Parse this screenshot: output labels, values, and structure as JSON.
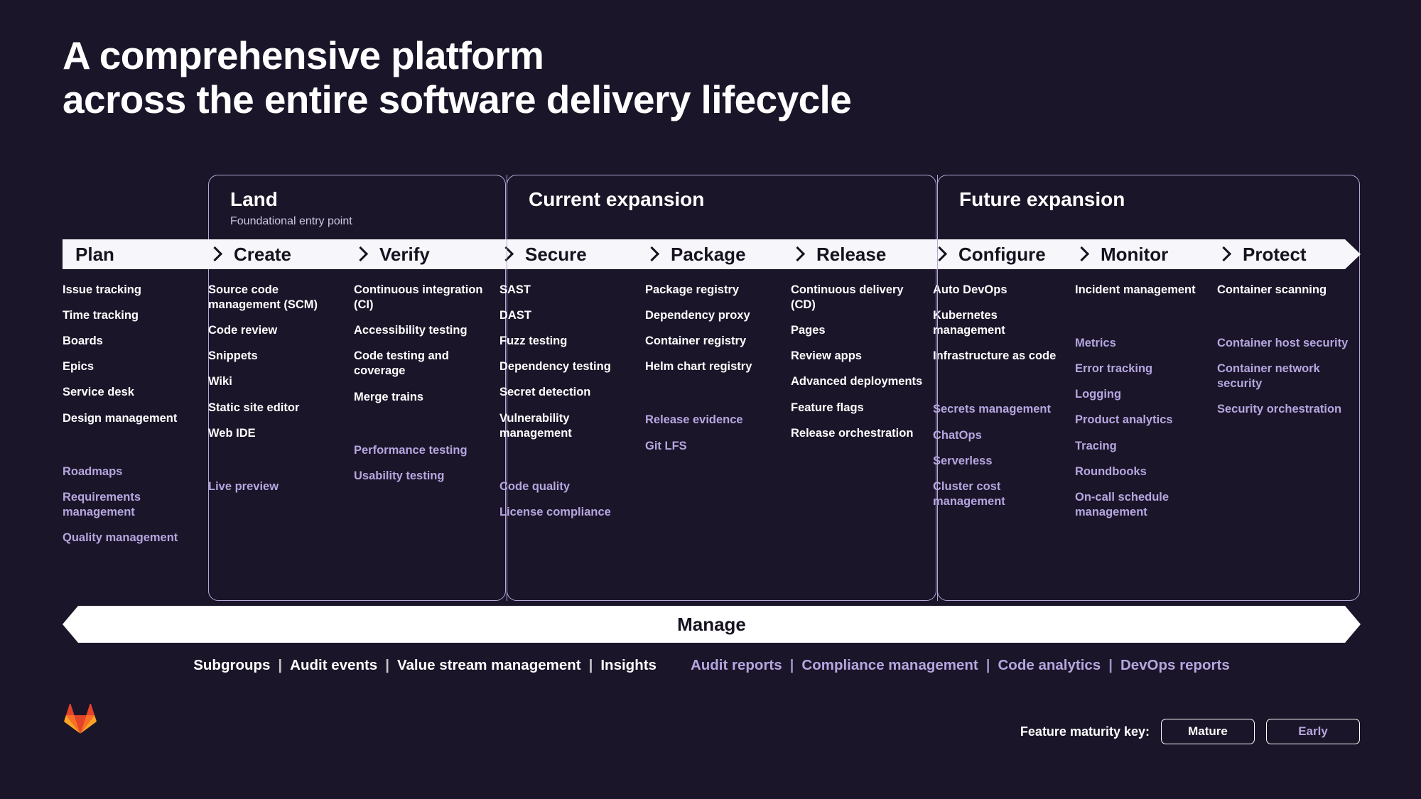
{
  "headline": {
    "line1": "A comprehensive platform",
    "line2": "across the entire software delivery lifecycle"
  },
  "groups": [
    {
      "title": "Land",
      "subtitle": "Foundational entry point"
    },
    {
      "title": "Current expansion",
      "subtitle": ""
    },
    {
      "title": "Future expansion",
      "subtitle": ""
    }
  ],
  "stages": [
    {
      "name": "Plan",
      "mature": [
        "Issue tracking",
        "Time tracking",
        "Boards",
        "Epics",
        "Service desk",
        "Design management"
      ],
      "early": [
        "Roadmaps",
        "Requirements management",
        "Quality management"
      ]
    },
    {
      "name": "Create",
      "mature": [
        "Source code management (SCM)",
        "Code review",
        "Snippets",
        "Wiki",
        "Static site editor",
        "Web IDE"
      ],
      "early": [
        "Live preview"
      ]
    },
    {
      "name": "Verify",
      "mature": [
        "Continuous integration (CI)",
        "Accessibility testing",
        "Code testing and coverage",
        "Merge trains"
      ],
      "early": [
        "Performance testing",
        "Usability testing"
      ]
    },
    {
      "name": "Secure",
      "mature": [
        "SAST",
        "DAST",
        "Fuzz testing",
        "Dependency testing",
        "Secret detection",
        "Vulnerability management"
      ],
      "early": [
        "Code quality",
        "License compliance"
      ]
    },
    {
      "name": "Package",
      "mature": [
        "Package registry",
        "Dependency proxy",
        "Container registry",
        "Helm chart registry"
      ],
      "early": [
        "Release evidence",
        "Git LFS"
      ]
    },
    {
      "name": "Release",
      "mature": [
        "Continuous delivery (CD)",
        "Pages",
        "Review apps",
        "Advanced deployments",
        "Feature flags",
        "Release orchestration"
      ],
      "early": []
    },
    {
      "name": "Configure",
      "mature": [
        "Auto DevOps",
        "Kubernetes management",
        "Infrastructure as code"
      ],
      "early": [
        "Secrets management",
        "ChatOps",
        "Serverless",
        "Cluster cost management"
      ]
    },
    {
      "name": "Monitor",
      "mature": [
        "Incident management"
      ],
      "early": [
        "Metrics",
        "Error tracking",
        "Logging",
        "Product analytics",
        "Tracing",
        "Roundbooks",
        "On-call schedule management"
      ]
    },
    {
      "name": "Protect",
      "mature": [
        "Container scanning"
      ],
      "early": [
        "Container host security",
        "Container network security",
        "Security orchestration"
      ]
    }
  ],
  "manage": {
    "label": "Manage",
    "mature_links": [
      "Subgroups",
      "Audit events",
      "Value stream management",
      "Insights"
    ],
    "early_links": [
      "Audit reports",
      "Compliance management",
      "Code analytics",
      "DevOps reports"
    ],
    "separator": "|"
  },
  "footer": {
    "maturity_key_label": "Feature maturity key:",
    "chip_mature": "Mature",
    "chip_early": "Early",
    "logo_name": "gitlab-tanuki-logo"
  },
  "colors": {
    "background": "#1a1528",
    "mature_text": "#ffffff",
    "early_text": "#b6a6e0",
    "bar_background": "#f7f7fb",
    "bar_text": "#16121f",
    "group_border": "#b6a6d8",
    "logo_orange": "#e24329",
    "logo_orange_light": "#fc6d26",
    "logo_yellow": "#fca326"
  }
}
